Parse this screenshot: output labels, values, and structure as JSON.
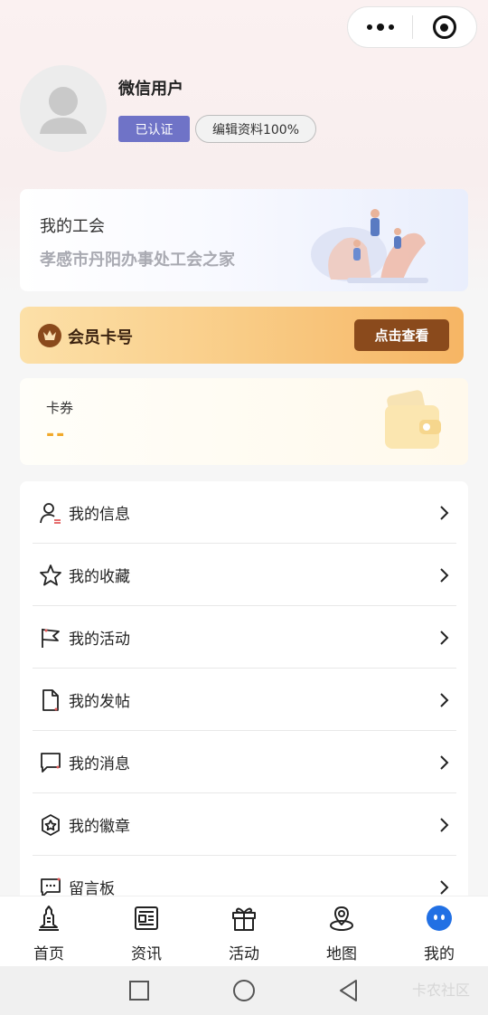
{
  "header": {
    "menu_icon": "more-dots-icon",
    "close_icon": "target-circle-icon"
  },
  "profile": {
    "avatar_icon": "default-avatar-icon",
    "username": "微信用户",
    "verified_label": "已认证",
    "edit_label": "编辑资料100%"
  },
  "union": {
    "title": "我的工会",
    "name": "孝感市丹阳办事处工会之家"
  },
  "vip": {
    "icon": "crown-icon",
    "label": "会员卡号",
    "button": "点击查看"
  },
  "coupon": {
    "title": "卡券",
    "value": "--",
    "icon": "wallet-icon"
  },
  "menu": {
    "items": [
      {
        "label": "我的信息",
        "icon": "user-info-icon"
      },
      {
        "label": "我的收藏",
        "icon": "star-icon"
      },
      {
        "label": "我的活动",
        "icon": "flag-icon"
      },
      {
        "label": "我的发帖",
        "icon": "document-icon"
      },
      {
        "label": "我的消息",
        "icon": "message-icon"
      },
      {
        "label": "我的徽章",
        "icon": "badge-icon"
      },
      {
        "label": "留言板",
        "icon": "comment-board-icon"
      }
    ]
  },
  "tabbar": {
    "items": [
      {
        "label": "首页",
        "icon": "home-tower-icon",
        "active": false
      },
      {
        "label": "资讯",
        "icon": "news-icon",
        "active": false
      },
      {
        "label": "活动",
        "icon": "gift-icon",
        "active": false
      },
      {
        "label": "地图",
        "icon": "map-pin-icon",
        "active": false
      },
      {
        "label": "我的",
        "icon": "profile-face-icon",
        "active": true
      }
    ]
  },
  "watermark": "卡农社区",
  "colors": {
    "accent_blue": "#2170e4",
    "verified_purple": "#6f73c7",
    "vip_brown": "#8a4a1c",
    "coupon_orange": "#f1a92a"
  }
}
